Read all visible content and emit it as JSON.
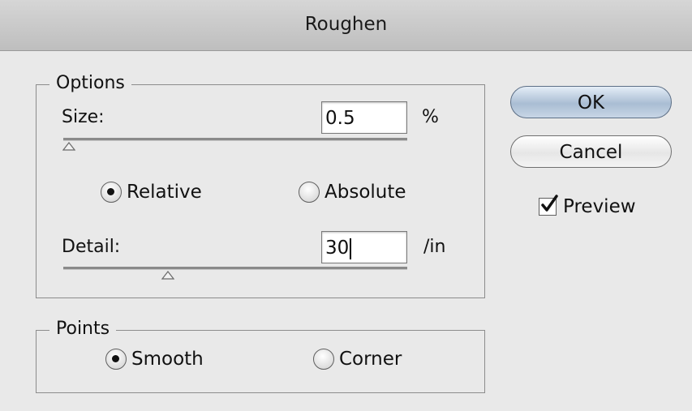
{
  "window": {
    "title": "Roughen"
  },
  "options": {
    "legend": "Options",
    "size": {
      "label": "Size:",
      "value": "0.5",
      "unit": "%",
      "slider_level_fraction": 0.02
    },
    "mode": {
      "relative_label": "Relative",
      "absolute_label": "Absolute",
      "selected": "Relative"
    },
    "detail": {
      "label": "Detail:",
      "value": "30",
      "unit": "/in",
      "slider_level_fraction": 0.3
    }
  },
  "points": {
    "legend": "Points",
    "smooth_label": "Smooth",
    "corner_label": "Corner",
    "selected": "Smooth"
  },
  "buttons": {
    "ok_label": "OK",
    "cancel_label": "Cancel"
  },
  "preview": {
    "label": "Preview",
    "checked": true
  },
  "colors": {
    "default_button": "#a9bdd3",
    "dialog_bg": "#e9e9e9"
  }
}
